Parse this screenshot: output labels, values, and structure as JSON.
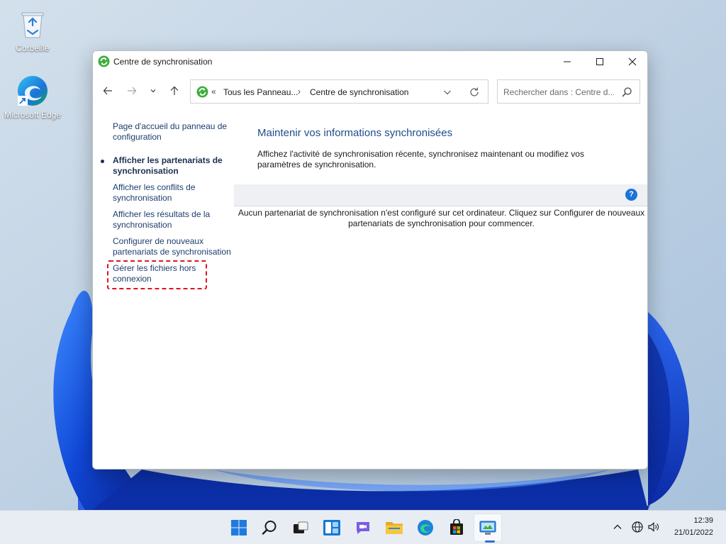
{
  "desktop": {
    "icons": [
      {
        "label": "Corbeille",
        "icon": "recycle-bin-icon"
      },
      {
        "label": "Microsoft Edge",
        "icon": "edge-icon"
      }
    ]
  },
  "window": {
    "title": "Centre de synchronisation",
    "controls": {
      "minimize": "minimize-icon",
      "maximize": "maximize-icon",
      "close": "close-icon"
    },
    "nav": {
      "back": "back-arrow-icon",
      "forward": "forward-arrow-icon",
      "recent": "chevron-down-icon",
      "up": "up-arrow-icon"
    },
    "address": {
      "prefix": "«",
      "crumbs": [
        "Tous les Panneau...",
        "Centre de synchronisation"
      ],
      "separator": "›"
    },
    "search": {
      "placeholder": "Rechercher dans : Centre d..."
    },
    "sidebar": {
      "items": [
        {
          "label": "Page d'accueil du panneau de configuration"
        },
        {
          "label": "Afficher les partenariats de synchronisation",
          "selected": true
        },
        {
          "label": "Afficher les conflits de synchronisation"
        },
        {
          "label": "Afficher les résultats de la synchronisation"
        },
        {
          "label": "Configurer de nouveaux partenariats de synchronisation"
        },
        {
          "label": "Gérer les fichiers hors connexion",
          "highlighted": true
        }
      ]
    },
    "main": {
      "heading": "Maintenir vos informations synchronisées",
      "description": "Affichez l'activité de synchronisation récente, synchronisez maintenant ou modifiez vos paramètres de synchronisation.",
      "help": "?",
      "empty_message": "Aucun partenariat de synchronisation n'est configuré sur cet ordinateur. Cliquez sur Configurer de nouveaux partenariats de synchronisation pour commencer."
    }
  },
  "taskbar": {
    "apps": [
      "start-icon",
      "search-icon",
      "task-view-icon",
      "widgets-icon",
      "teams-chat-icon",
      "file-explorer-icon",
      "edge-icon",
      "store-icon",
      "control-panel-icon"
    ],
    "active_app": "control-panel-icon",
    "tray": [
      "chevron-up-icon",
      "network-icon",
      "volume-icon"
    ],
    "time": "12:39",
    "date": "21/01/2022"
  },
  "colors": {
    "accent": "#1e4d8c",
    "highlight_border": "#e0141e",
    "help": "#1a73d8"
  }
}
